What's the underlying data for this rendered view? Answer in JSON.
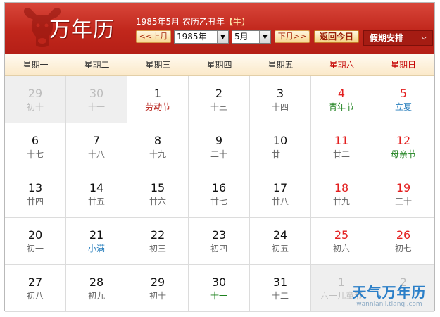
{
  "header": {
    "title": "万年历",
    "date_info": "1985年5月 农历乙丑年",
    "zodiac": "【牛】",
    "prev_month_label": "<<上月",
    "year_value": "1985年",
    "month_value": "5月",
    "next_month_label": "下月>>",
    "today_label": "返回今日",
    "holiday_menu_label": "假期安排",
    "holiday_menu_icon": "chevron-down-icon",
    "emblem_icon": "ox-icon"
  },
  "colors": {
    "header_red": "#c1271c",
    "weekend_red": "#e31f1f",
    "holiday_red": "#b51b14",
    "festival_green": "#1a7f1a",
    "solar_term_blue": "#2a7fbd"
  },
  "weekdays": [
    "星期一",
    "星期二",
    "星期三",
    "星期四",
    "星期五",
    "星期六",
    "星期日"
  ],
  "days": [
    {
      "num": "29",
      "sub": "初十",
      "type": "",
      "other": true,
      "weekend": false
    },
    {
      "num": "30",
      "sub": "十一",
      "type": "",
      "other": true,
      "weekend": false
    },
    {
      "num": "1",
      "sub": "劳动节",
      "type": "holiday",
      "other": false,
      "weekend": false
    },
    {
      "num": "2",
      "sub": "十三",
      "type": "",
      "other": false,
      "weekend": false
    },
    {
      "num": "3",
      "sub": "十四",
      "type": "",
      "other": false,
      "weekend": false
    },
    {
      "num": "4",
      "sub": "青年节",
      "type": "youth",
      "other": false,
      "weekend": true
    },
    {
      "num": "5",
      "sub": "立夏",
      "type": "term",
      "other": false,
      "weekend": true
    },
    {
      "num": "6",
      "sub": "十七",
      "type": "",
      "other": false,
      "weekend": false
    },
    {
      "num": "7",
      "sub": "十八",
      "type": "",
      "other": false,
      "weekend": false
    },
    {
      "num": "8",
      "sub": "十九",
      "type": "",
      "other": false,
      "weekend": false
    },
    {
      "num": "9",
      "sub": "二十",
      "type": "",
      "other": false,
      "weekend": false
    },
    {
      "num": "10",
      "sub": "廿一",
      "type": "",
      "other": false,
      "weekend": false
    },
    {
      "num": "11",
      "sub": "廿二",
      "type": "",
      "other": false,
      "weekend": true
    },
    {
      "num": "12",
      "sub": "母亲节",
      "type": "festival",
      "other": false,
      "weekend": true
    },
    {
      "num": "13",
      "sub": "廿四",
      "type": "",
      "other": false,
      "weekend": false
    },
    {
      "num": "14",
      "sub": "廿五",
      "type": "",
      "other": false,
      "weekend": false
    },
    {
      "num": "15",
      "sub": "廿六",
      "type": "",
      "other": false,
      "weekend": false
    },
    {
      "num": "16",
      "sub": "廿七",
      "type": "",
      "other": false,
      "weekend": false
    },
    {
      "num": "17",
      "sub": "廿八",
      "type": "",
      "other": false,
      "weekend": false
    },
    {
      "num": "18",
      "sub": "廿九",
      "type": "",
      "other": false,
      "weekend": true
    },
    {
      "num": "19",
      "sub": "三十",
      "type": "",
      "other": false,
      "weekend": true
    },
    {
      "num": "20",
      "sub": "初一",
      "type": "",
      "other": false,
      "weekend": false
    },
    {
      "num": "21",
      "sub": "小满",
      "type": "term",
      "other": false,
      "weekend": false
    },
    {
      "num": "22",
      "sub": "初三",
      "type": "",
      "other": false,
      "weekend": false
    },
    {
      "num": "23",
      "sub": "初四",
      "type": "",
      "other": false,
      "weekend": false
    },
    {
      "num": "24",
      "sub": "初五",
      "type": "",
      "other": false,
      "weekend": false
    },
    {
      "num": "25",
      "sub": "初六",
      "type": "",
      "other": false,
      "weekend": true
    },
    {
      "num": "26",
      "sub": "初七",
      "type": "",
      "other": false,
      "weekend": true
    },
    {
      "num": "27",
      "sub": "初八",
      "type": "",
      "other": false,
      "weekend": false
    },
    {
      "num": "28",
      "sub": "初九",
      "type": "",
      "other": false,
      "weekend": false
    },
    {
      "num": "29",
      "sub": "初十",
      "type": "",
      "other": false,
      "weekend": false
    },
    {
      "num": "30",
      "sub": "十一",
      "type": "lunar-first",
      "other": false,
      "weekend": false
    },
    {
      "num": "31",
      "sub": "十二",
      "type": "",
      "other": false,
      "weekend": false
    },
    {
      "num": "1",
      "sub": "六一儿童节",
      "type": "festival",
      "other": true,
      "weekend": true
    },
    {
      "num": "2",
      "sub": "",
      "type": "",
      "other": true,
      "weekend": true
    }
  ],
  "watermark": {
    "brand": "天气万年历",
    "url": "wannianli.tianqi.com"
  }
}
